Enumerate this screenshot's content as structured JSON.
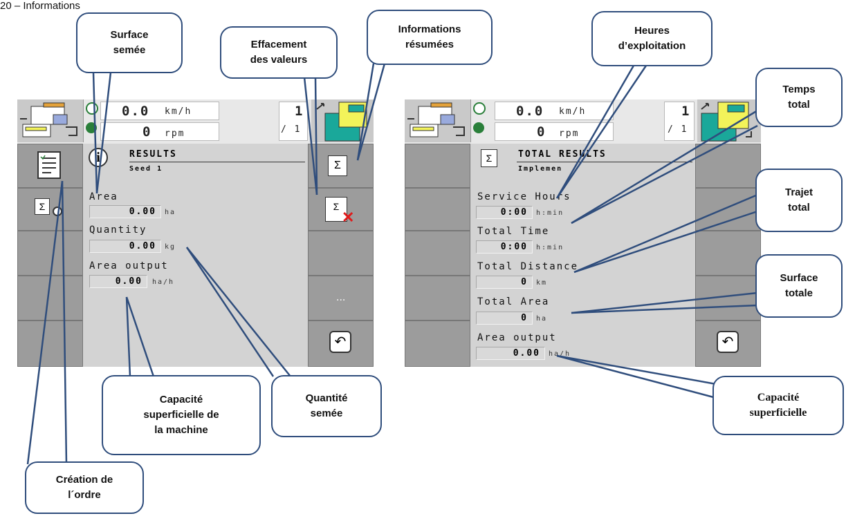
{
  "page_heading": "20 – Informations",
  "left_screen": {
    "speed": "0.0",
    "speed_unit": "km/h",
    "rpm": "0",
    "rpm_unit": "rpm",
    "counter_top": "1",
    "counter_bottom": "/ 1",
    "title": "RESULTS",
    "subtitle": "Seed 1",
    "rows": [
      {
        "label": "Area",
        "value": "0.00",
        "unit": "ha"
      },
      {
        "label": "Quantity",
        "value": "0.00",
        "unit": "kg"
      },
      {
        "label": "Area output",
        "value": "0.00",
        "unit": "ha/h"
      }
    ],
    "more_label": "..."
  },
  "right_screen": {
    "speed": "0.0",
    "speed_unit": "km/h",
    "rpm": "0",
    "rpm_unit": "rpm",
    "counter_top": "1",
    "counter_bottom": "/ 1",
    "title": "TOTAL RESULTS",
    "subtitle": "Implemen",
    "rows": [
      {
        "label": "Service Hours",
        "value": "0:00",
        "unit": "h:min"
      },
      {
        "label": "Total Time",
        "value": "0:00",
        "unit": "h:min"
      },
      {
        "label": "Total Distance",
        "value": "0",
        "unit": "km"
      },
      {
        "label": "Total Area",
        "value": "0",
        "unit": "ha"
      },
      {
        "label": "Area output",
        "value": "0.00",
        "unit": "ha/h"
      }
    ]
  },
  "callouts": {
    "surface_semee": [
      "Surface",
      "semée"
    ],
    "effacement": [
      "Effacement",
      "des valeurs"
    ],
    "informations": [
      "Informations",
      "résumées"
    ],
    "heures": [
      "Heures",
      "d’exploitation"
    ],
    "temps_total": [
      "Temps",
      "total"
    ],
    "trajet_total": [
      "Trajet",
      "total"
    ],
    "surface_totale": [
      "Surface",
      "totale"
    ],
    "capacite_machine": [
      "Capacité",
      "superficielle de",
      "la machine"
    ],
    "quantite_semee": [
      "Quantité",
      "semée"
    ],
    "capacite_superficielle": [
      "Capacité",
      "superficielle"
    ],
    "creation_ordre": [
      "Création de",
      "l´ordre"
    ]
  },
  "colors": {
    "callout_border": "#2f4d7c",
    "screen_bg": "#d3d3d3",
    "softkey": "#9c9c9c",
    "machine_yellow": "#f3f35a",
    "machine_teal": "#1aa89a",
    "machine_orange": "#e4a23a"
  }
}
